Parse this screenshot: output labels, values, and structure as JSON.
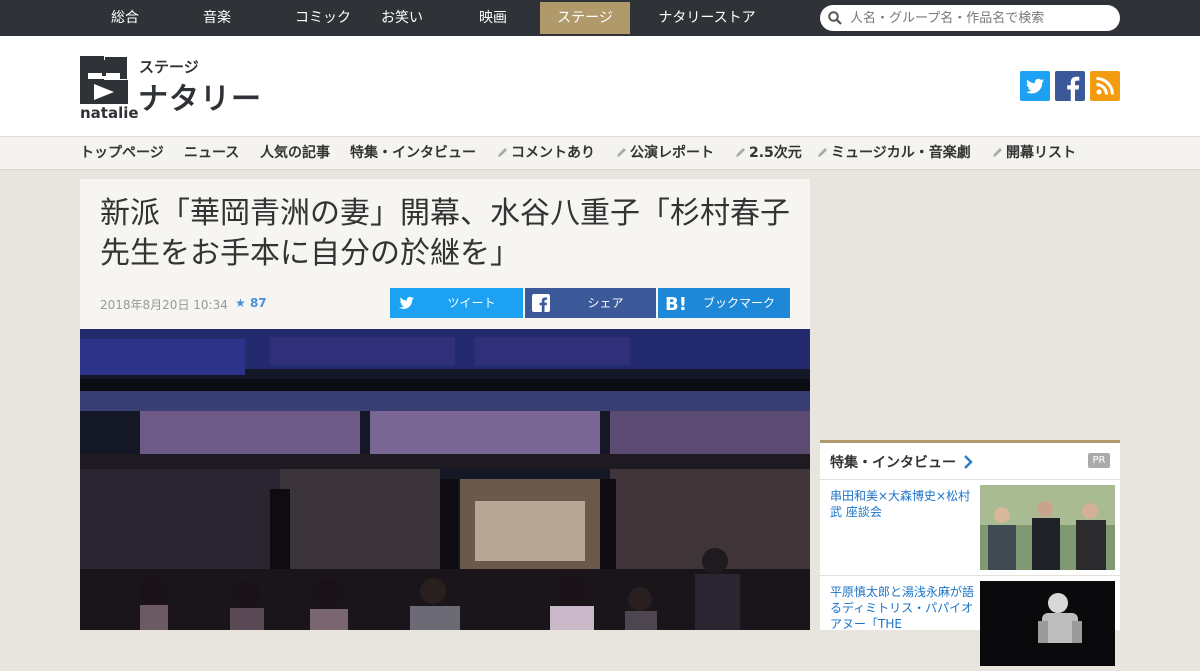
{
  "top_nav": {
    "items": [
      "総合",
      "音楽",
      "コミック",
      "お笑い",
      "映画",
      "ステージ",
      "ナタリーストア"
    ],
    "active": "ステージ"
  },
  "search": {
    "placeholder": "人名・グループ名・作品名で検索"
  },
  "logo": {
    "sub": "ステージ",
    "main": "ナタリー",
    "en": "natalie"
  },
  "social": {
    "twitter_icon": "twitter-icon",
    "facebook_icon": "facebook-icon",
    "rss_icon": "rss-icon",
    "colors": {
      "twitter": "#1da1f2",
      "facebook": "#3b5998",
      "rss": "#f39c12"
    }
  },
  "sub_nav": {
    "items": [
      "トップページ",
      "ニュース",
      "人気の記事",
      "特集・インタビュー",
      "コメントあり",
      "公演レポート",
      "2.5次元",
      "ミュージカル・音楽劇",
      "開幕リスト"
    ]
  },
  "article": {
    "title": "新派「華岡青洲の妻」開幕、水谷八重子「杉村春子先生をお手本に自分の於継を」",
    "date": "2018年8月20日 10:34",
    "star_count": "87",
    "share": {
      "tweet": "ツイート",
      "facebook": "シェア",
      "bookmark": "ブックマーク"
    }
  },
  "sidebar": {
    "feature_heading": "特集・インタビュー",
    "pr": "PR",
    "items": [
      {
        "title": "串田和美×大森博史×松村武 座談会"
      },
      {
        "title": "平原慎太郎と湯浅永麻が語るディミトリス・パパイオアヌー「THE"
      }
    ]
  },
  "colors": {
    "accent": "#b09a6b",
    "nav_bg": "#2f3237",
    "link": "#1a73c9",
    "share_twitter": "#1da1f2",
    "share_facebook": "#3b5998",
    "share_hatena": "#1e88d8"
  }
}
